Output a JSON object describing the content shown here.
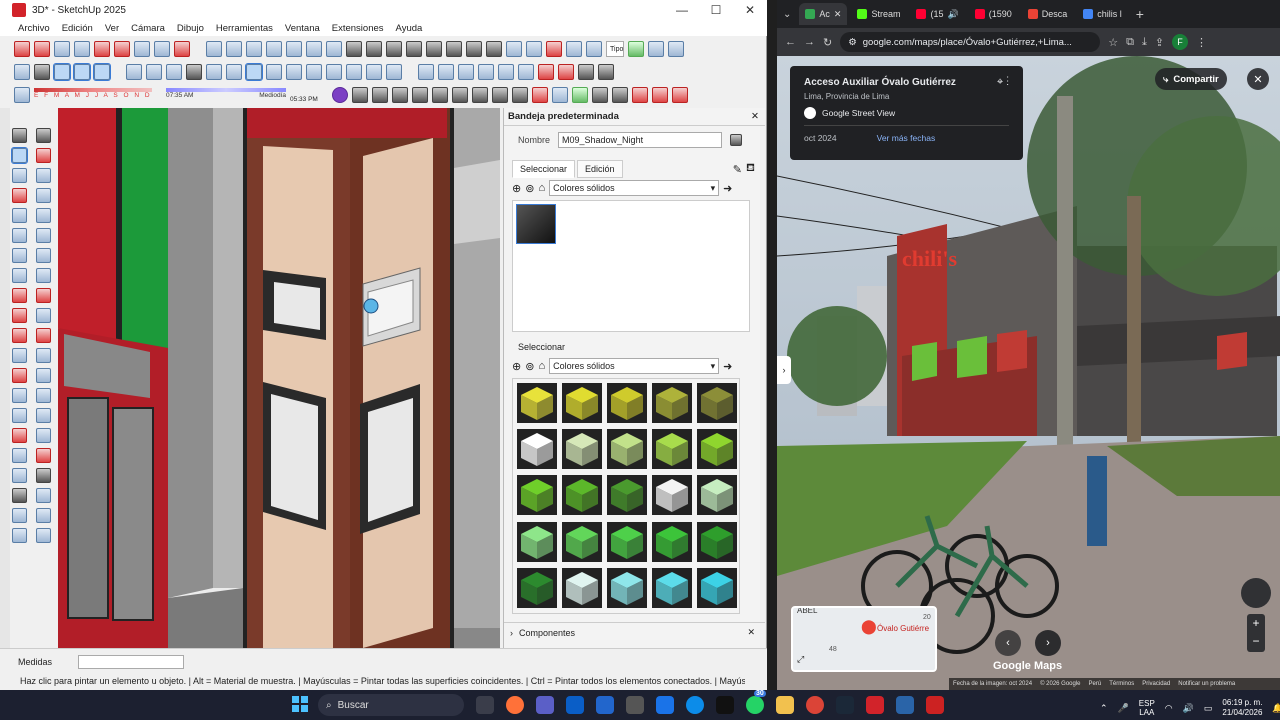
{
  "sketchup": {
    "title": "3D* - SketchUp 2025",
    "menu": [
      "Archivo",
      "Edición",
      "Ver",
      "Cámara",
      "Dibujo",
      "Herramientas",
      "Ventana",
      "Extensiones",
      "Ayuda"
    ],
    "shadow_months": "E F M A M J J A S O N D",
    "time_start": "07:35 AM",
    "time_mid": "Mediodía",
    "time_end": "05:33 PM",
    "style_label": "Tipo",
    "tray": {
      "title": "Bandeja predeterminada",
      "name_label": "Nombre",
      "name_value": "M09_Shadow_Night",
      "tab_select": "Seleccionar",
      "tab_edit": "Edición",
      "library": "Colores sólidos",
      "select2": "Seleccionar",
      "library2": "Colores sólidos",
      "components": "Componentes",
      "swatch_colors": [
        [
          "#e8e23a",
          "#e0dc30",
          "#cfcb2c",
          "#aeb23a",
          "#8c8e38"
        ],
        [
          "#ffffff",
          "#d6e8b8",
          "#c2e28a",
          "#a8dc4c",
          "#8fd62e"
        ],
        [
          "#6fcf2a",
          "#5cb82a",
          "#4a9a2e",
          "#f4f4f4",
          "#c6eec0"
        ],
        [
          "#8ee68a",
          "#62d65a",
          "#4ed04a",
          "#3cc43a",
          "#2e9e2c"
        ],
        [
          "#2c8a2e",
          "#e0f4f0",
          "#8ee6ea",
          "#5cdcea",
          "#3cd2e6"
        ]
      ]
    },
    "status": {
      "measures_label": "Medidas",
      "hint": "Haz clic para pintar un elemento u objeto. | Alt = Material de muestra. | Mayúsculas = Pintar todas las superficies coincidentes. | Ctrl = Pintar todos los elementos conectados. | Mayúsculas"
    }
  },
  "chrome": {
    "tabs": [
      {
        "label": "Ac",
        "color": "#34a853",
        "active": true
      },
      {
        "label": "Stream",
        "color": "#53fc18",
        "active": false
      },
      {
        "label": "(15",
        "color": "#ff0033",
        "active": false
      },
      {
        "label": "(1590",
        "color": "#ff0033",
        "active": false
      },
      {
        "label": "Desca",
        "color": "#ea4335",
        "active": false
      },
      {
        "label": "chilis l",
        "color": "#4285f4",
        "active": false
      }
    ],
    "url": "google.com/maps/place/Óvalo+Gutiérrez,+Lima...",
    "profile": "F",
    "maps": {
      "place_title": "Acceso Auxiliar Óvalo Gutiérrez",
      "place_sub": "Lima, Provincia de Lima",
      "source": "Google Street View",
      "date": "oct 2024",
      "more_dates": "Ver más fechas",
      "share": "Compartir",
      "sign": "chili's",
      "minimap_place": "Óvalo Gutiérre",
      "minimap_label1": "ABEL",
      "minimap_label2": "48",
      "minimap_label3": "20",
      "brand": "Google Maps",
      "footer": [
        "Fecha de la imagen: oct 2024",
        "© 2026 Google",
        "Perú",
        "Términos",
        "Privacidad",
        "Notificar un problema"
      ]
    }
  },
  "taskbar": {
    "search": "Buscar",
    "lang1": "ESP",
    "lang2": "LAA",
    "time": "06:19 p. m.",
    "date": "21/04/2026",
    "badge": "30"
  }
}
